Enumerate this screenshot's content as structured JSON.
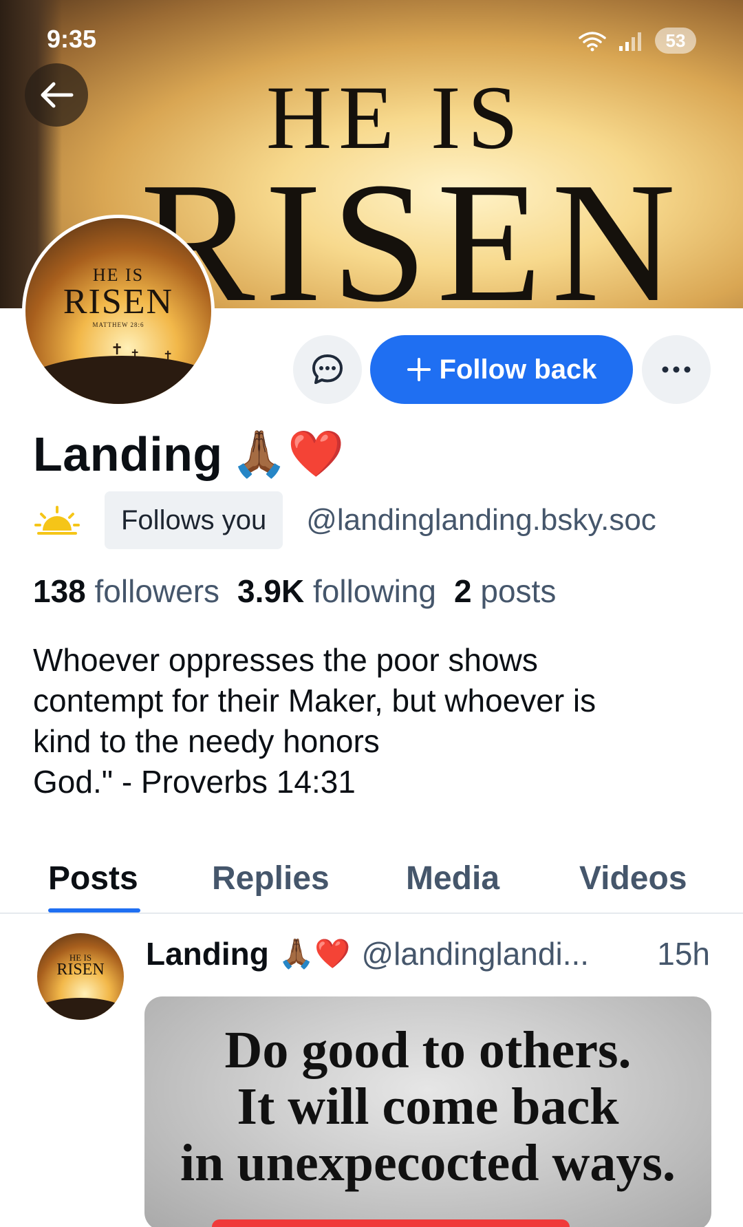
{
  "status_bar": {
    "time": "9:35",
    "battery": "53"
  },
  "banner": {
    "line1": "HE IS",
    "line2": "RISEN"
  },
  "avatar": {
    "line1": "HE IS",
    "line2": "RISEN",
    "line3": "MATTHEW 28:6"
  },
  "actions": {
    "follow_label": "Follow back"
  },
  "profile": {
    "name": "Landing",
    "name_emojis": "🙏🏾❤️",
    "badge": "Follows you",
    "handle": "@landinglanding.bsky.soc",
    "followers_count": "138",
    "followers_label": "followers",
    "following_count": "3.9K",
    "following_label": "following",
    "posts_count": "2",
    "posts_label": "posts",
    "bio": "Whoever oppresses the poor shows\ncontempt for their Maker, but whoever is\nkind to the needy honors\nGod.\" - Proverbs 14:31"
  },
  "tabs": [
    {
      "label": "Posts",
      "active": true
    },
    {
      "label": "Replies",
      "active": false
    },
    {
      "label": "Media",
      "active": false
    },
    {
      "label": "Videos",
      "active": false
    }
  ],
  "post": {
    "author": "Landing",
    "emojis": "🙏🏾❤️",
    "handle": "@landinglandi...",
    "time": "15h",
    "avatar_line1": "HE IS",
    "avatar_line2": "RISEN",
    "image_text": [
      "Do good to others.",
      "It will come back",
      "in unexpecocted ways."
    ]
  },
  "colors": {
    "accent": "#1f6ff2",
    "muted_text": "#45566b",
    "underline_red": "#f03a3a"
  },
  "icons": [
    "arrow-left-icon",
    "wifi-icon",
    "signal-icon",
    "chat-bubble-icon",
    "plus-icon",
    "more-dots-icon",
    "sun-icon"
  ]
}
